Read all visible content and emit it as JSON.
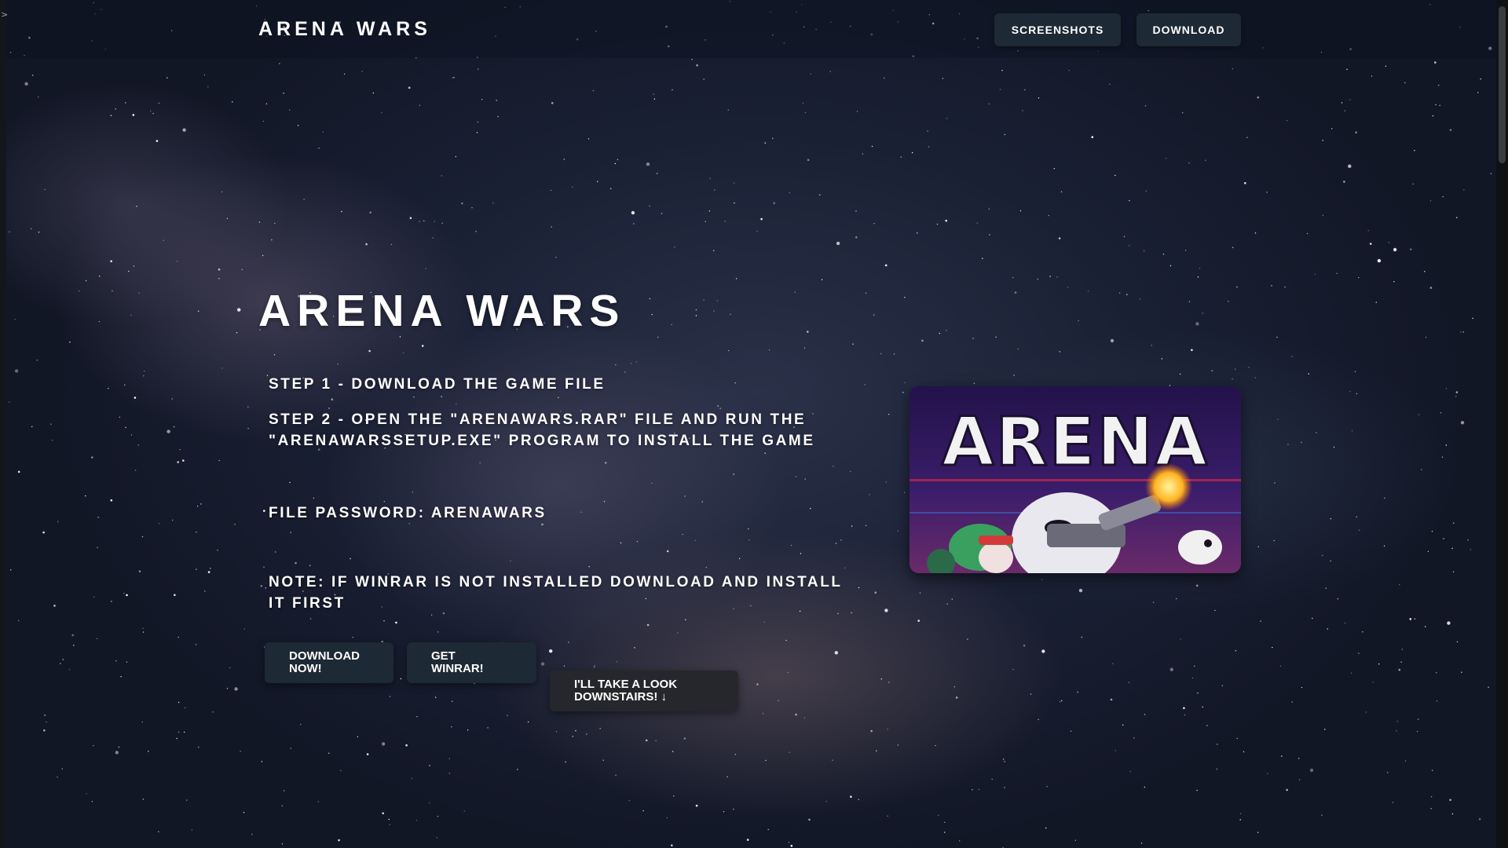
{
  "nav": {
    "brand": "ARENA WARS",
    "screenshots_label": "SCREENSHOTS",
    "download_label": "DOWNLOAD"
  },
  "hero": {
    "title": "ARENA WARS",
    "step1": "STEP 1 - DOWNLOAD THE GAME FILE",
    "step2": "STEP 2 - OPEN THE \"ARENAWARS.RAR\" FILE AND RUN THE \"ARENAWARSSETUP.EXE\" PROGRAM TO INSTALL THE GAME",
    "password": "FILE PASSWORD: ARENAWARS",
    "note": "NOTE: IF WINRAR IS NOT INSTALLED DOWNLOAD AND INSTALL IT FIRST"
  },
  "buttons": {
    "download_now_line1": "DOWNLOAD",
    "download_now_line2": "NOW!",
    "get_winrar_line1": "GET",
    "get_winrar_line2": "WINRAR!",
    "look_line1": "I'LL TAKE A LOOK",
    "look_line2": "DOWNSTAIRS! ↓"
  },
  "game_image": {
    "logo_text": "ARENA"
  },
  "colors": {
    "button_bg": "#1d2934",
    "text": "#ffffff"
  }
}
